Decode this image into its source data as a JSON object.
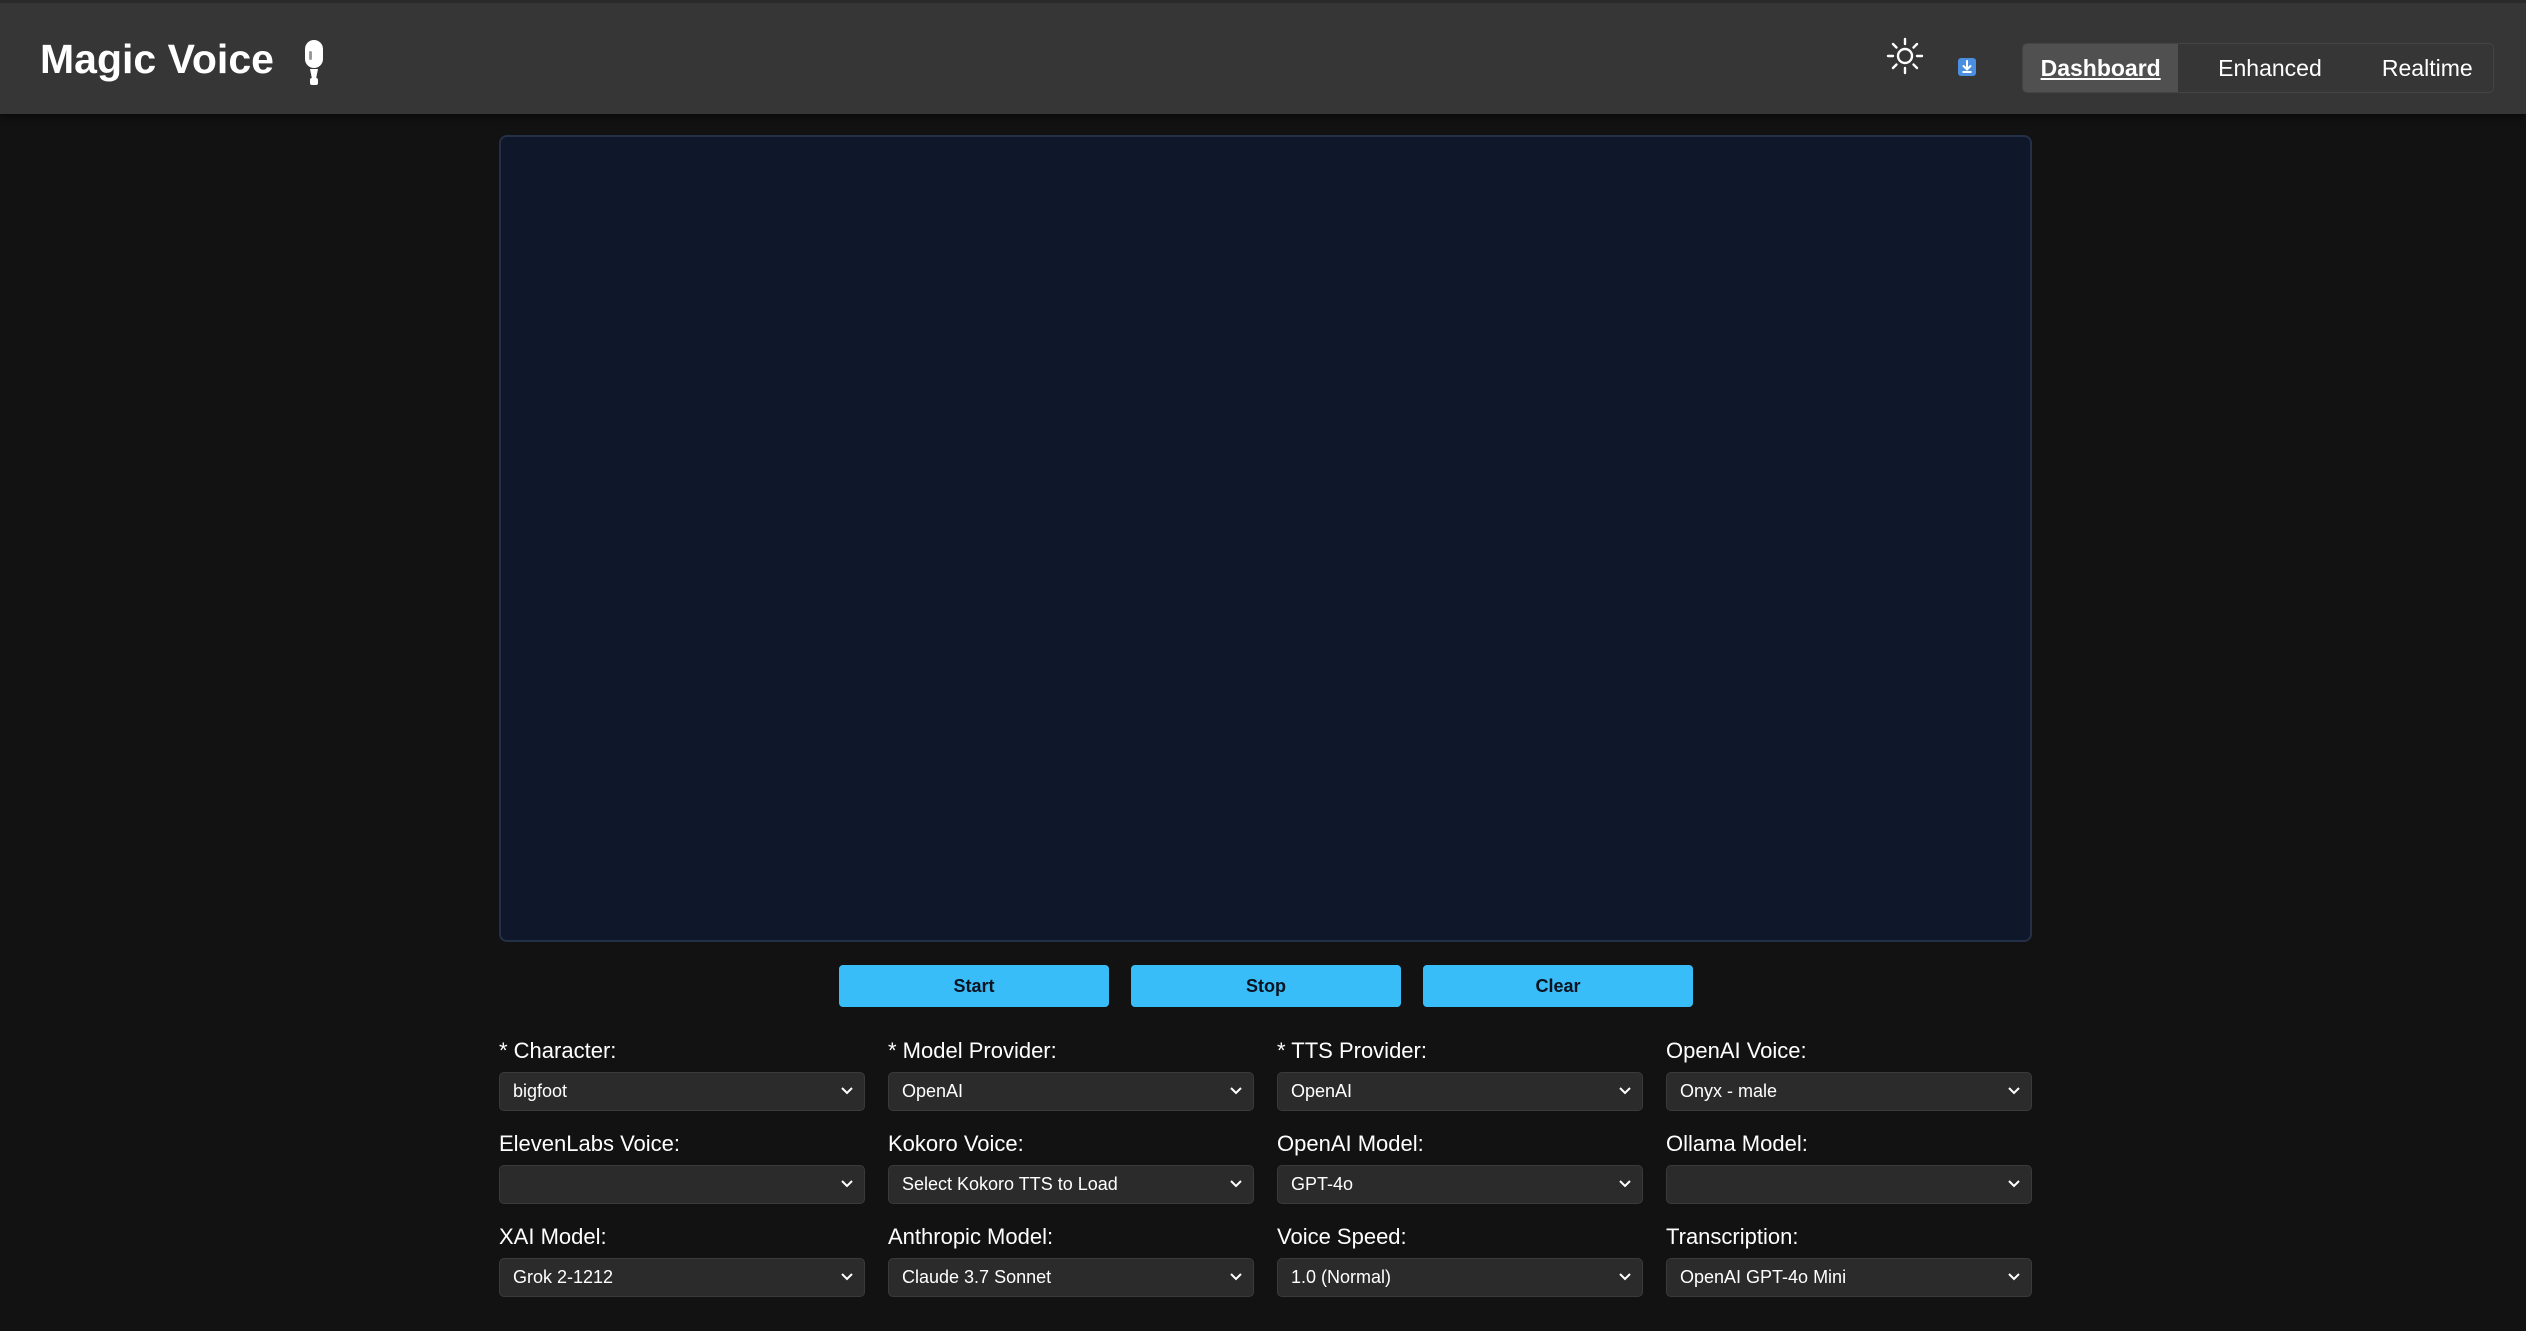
{
  "app": {
    "title": "Magic Voice"
  },
  "nav": {
    "tabs": [
      {
        "label": "Dashboard"
      },
      {
        "label": "Enhanced"
      },
      {
        "label": "Realtime"
      }
    ]
  },
  "controls": {
    "start_label": "Start",
    "stop_label": "Stop",
    "clear_label": "Clear"
  },
  "settings": [
    {
      "label": "* Character:",
      "value": "bigfoot"
    },
    {
      "label": "* Model Provider:",
      "value": "OpenAI"
    },
    {
      "label": "* TTS Provider:",
      "value": "OpenAI"
    },
    {
      "label": "OpenAI Voice:",
      "value": "Onyx - male"
    },
    {
      "label": "ElevenLabs Voice:",
      "value": ""
    },
    {
      "label": "Kokoro Voice:",
      "value": "Select Kokoro TTS to Load"
    },
    {
      "label": "OpenAI Model:",
      "value": "GPT-4o"
    },
    {
      "label": "Ollama Model:",
      "value": ""
    },
    {
      "label": "XAI Model:",
      "value": "Grok 2-1212"
    },
    {
      "label": "Anthropic Model:",
      "value": "Claude 3.7 Sonnet"
    },
    {
      "label": "Voice Speed:",
      "value": "1.0 (Normal)"
    },
    {
      "label": "Transcription:",
      "value": "OpenAI GPT-4o Mini"
    }
  ],
  "icons": {
    "logo": "microphone-icon",
    "theme": "sun-icon",
    "download": "download-icon",
    "dropdown": "chevron-down-icon"
  },
  "colors": {
    "accent": "#38bdf8",
    "header_bg": "#363636",
    "page_bg": "#121212",
    "panel_bg": "#0f172a",
    "select_bg": "#2b2b2b"
  }
}
